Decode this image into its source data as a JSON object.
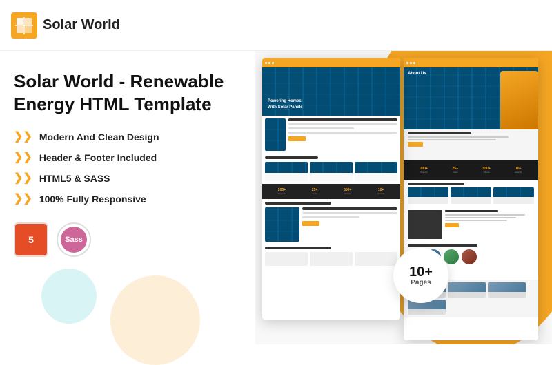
{
  "header": {
    "logo_text": "Solar World",
    "logo_icon_label": "solar-logo"
  },
  "main_title": "Solar World - Renewable Energy HTML Template",
  "features": [
    "Modern And Clean Design",
    "Header & Footer Included",
    "HTML5 & SASS",
    "100% Fully Responsive"
  ],
  "tech_badges": [
    {
      "label": "HTML5",
      "id": "html5"
    },
    {
      "label": "Sass",
      "id": "sass"
    }
  ],
  "pages_badge": {
    "count": "10+",
    "label": "Pages"
  }
}
